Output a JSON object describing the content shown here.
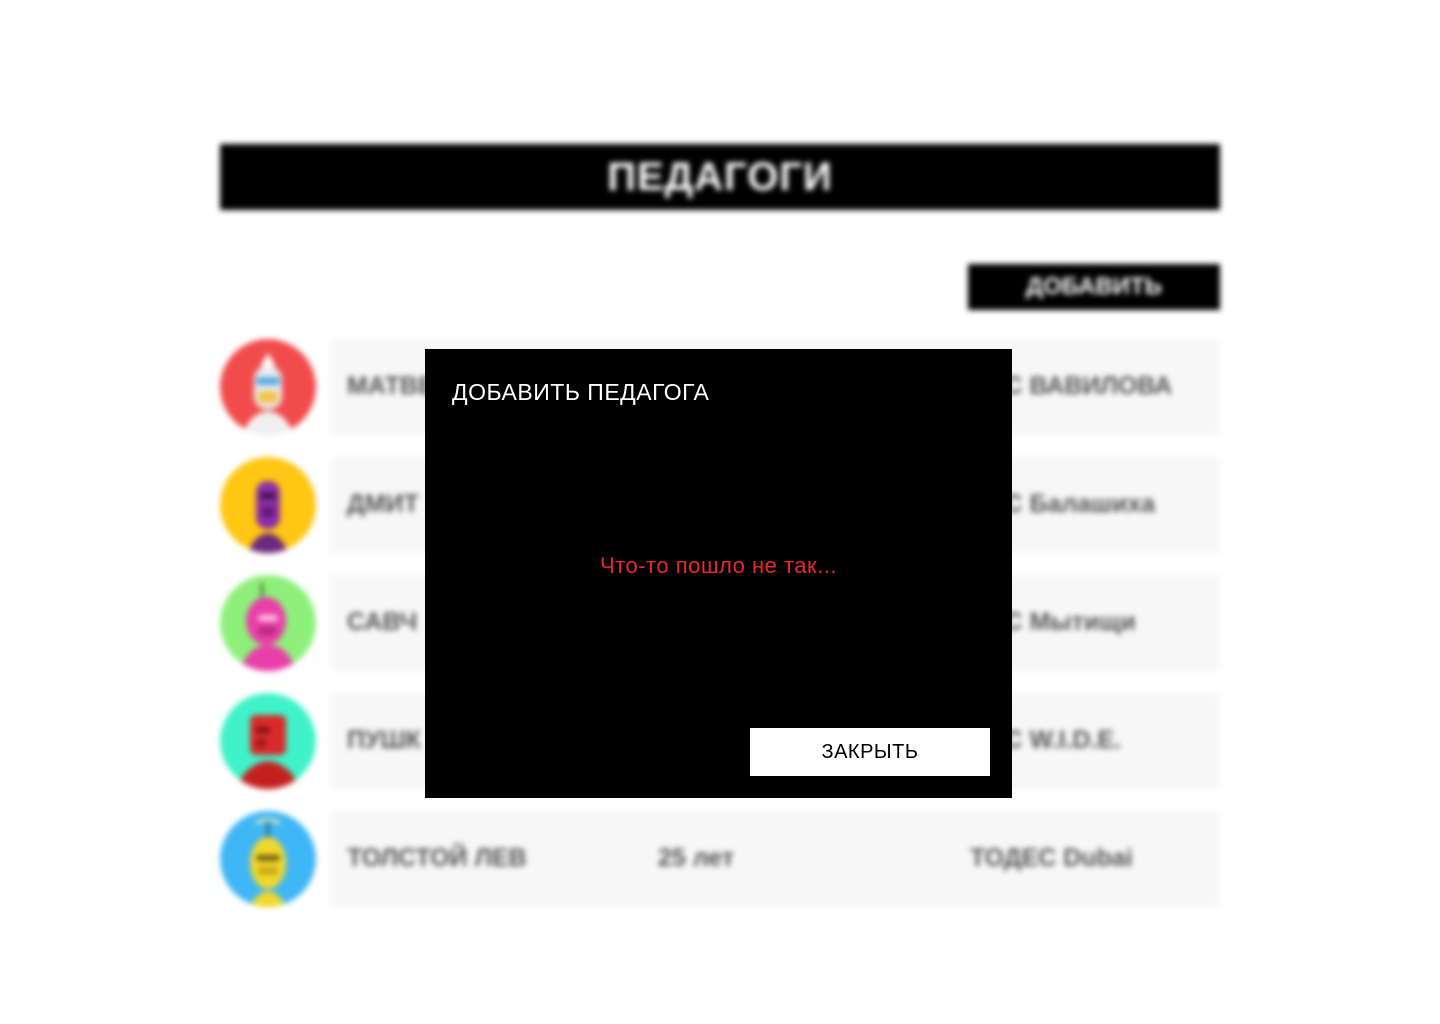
{
  "page": {
    "title": "ПЕДАГОГИ",
    "add_button_label": "ДОБАВИТЬ"
  },
  "teachers": [
    {
      "name": "МАТВЕ",
      "age": "",
      "studio": "ДЕС ВАВИЛОВА",
      "avatar_icon": "robot-avatar-white-icon",
      "avatar_color": "#f24b4b"
    },
    {
      "name": "ДМИТ",
      "age": "",
      "studio": "ДЕС Балашиха",
      "avatar_icon": "robot-avatar-purple-icon",
      "avatar_color": "#ffc613"
    },
    {
      "name": "САВЧ",
      "age": "",
      "studio": "ДЕС Мытищи",
      "avatar_icon": "robot-avatar-pink-icon",
      "avatar_color": "#8ef07a"
    },
    {
      "name": "ПУШК",
      "age": "",
      "studio": "ДЕС W.I.D.E.",
      "avatar_icon": "robot-avatar-red-icon",
      "avatar_color": "#40f2c8"
    },
    {
      "name": "ТОЛСТОЙ ЛЕВ",
      "age": "25 лет",
      "studio": "ТОДЕС Dubai",
      "avatar_icon": "robot-avatar-yellow-icon",
      "avatar_color": "#3fb6f5"
    }
  ],
  "modal": {
    "title": "ДОБАВИТЬ ПЕДАГОГА",
    "error_message": "Что-то пошло не так...",
    "close_label": "ЗАКРЫТЬ"
  },
  "colors": {
    "error": "#e8282b",
    "modal_bg": "#000000",
    "row_bg": "#f7f7f7"
  }
}
